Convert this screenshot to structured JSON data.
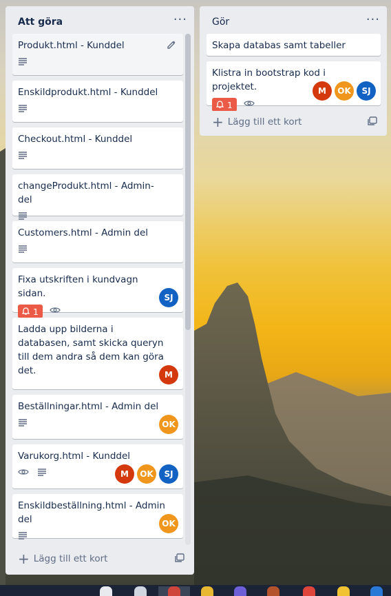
{
  "lists": [
    {
      "title": "Att göra",
      "menu_label": "···",
      "add_card_label": "Lägg till ett kort",
      "cards": [
        {
          "title": "Produkt.html - Kunddel"
        },
        {
          "title": "Enskildprodukt.html - Kunddel"
        },
        {
          "title": "Checkout.html - Kunddel"
        },
        {
          "title": "changeProdukt.html - Admin-del"
        },
        {
          "title": "Customers.html - Admin del"
        },
        {
          "title": "Fixa utskriften i kundvagn sidan.",
          "alarm_count": "1",
          "members": [
            "SJ"
          ]
        },
        {
          "title": "Ladda upp bilderna i databasen, samt skicka queryn till dem andra så dem kan göra det.",
          "members": [
            "M"
          ]
        },
        {
          "title": "Beställningar.html - Admin del",
          "members": [
            "OK"
          ]
        },
        {
          "title": "Varukorg.html - Kunddel",
          "members": [
            "M",
            "OK",
            "SJ"
          ]
        },
        {
          "title": "Enskildbeställning.html - Admin del",
          "members": [
            "OK"
          ]
        }
      ]
    },
    {
      "title": "Gör",
      "menu_label": "···",
      "add_card_label": "Lägg till ett kort",
      "cards": [
        {
          "title": "Skapa databas samt tabeller"
        },
        {
          "title": "Klistra in bootstrap kod i projektet.",
          "alarm_count": "1",
          "members": [
            "M",
            "OK",
            "SJ"
          ]
        }
      ]
    }
  ],
  "colors": {
    "list_bg": "#ebecf0",
    "card_bg": "#ffffff",
    "alarm_red": "#eb5a46",
    "avatar_M": "#d4380d",
    "avatar_OK": "#f0961c",
    "avatar_SJ": "#1262c4"
  }
}
